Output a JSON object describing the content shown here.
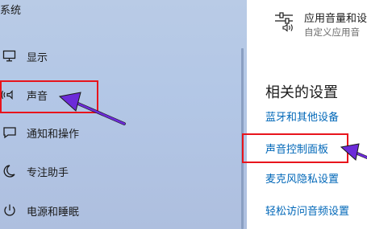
{
  "sidebar": {
    "title": "系统",
    "items": [
      {
        "label": "显示",
        "icon": "monitor-icon"
      },
      {
        "label": "声音",
        "icon": "speaker-icon"
      },
      {
        "label": "通知和操作",
        "icon": "notification-icon"
      },
      {
        "label": "专注助手",
        "icon": "moon-icon"
      },
      {
        "label": "电源和睡眠",
        "icon": "power-icon"
      }
    ]
  },
  "app_volume": {
    "icon": "mixer-sliders-icon",
    "title": "应用音量和设",
    "subtitle": "自定义应用音"
  },
  "related": {
    "heading": "相关的设置",
    "links": [
      {
        "label": "蓝牙和其他设备"
      },
      {
        "label": "声音控制面板"
      },
      {
        "label": "麦克风隐私设置"
      },
      {
        "label": "轻松访问音频设置"
      }
    ]
  },
  "annotations": {
    "highlight_color": "#e8141c",
    "arrow_color": "#6c2bd9"
  }
}
